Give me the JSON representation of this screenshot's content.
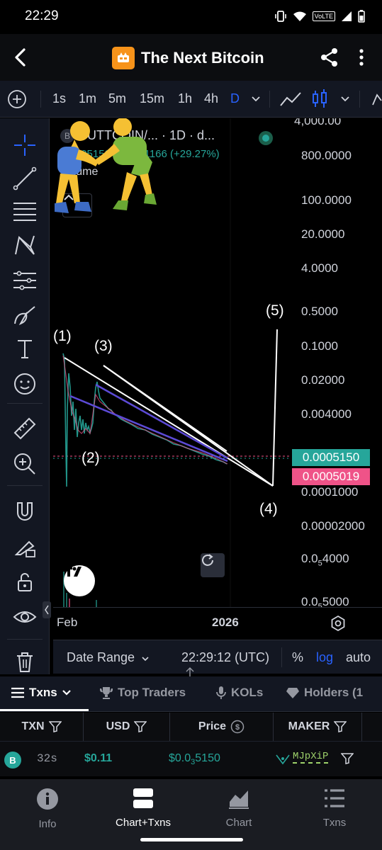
{
  "status_bar": {
    "time": "22:29",
    "network_label": "VoLTE",
    "icons": [
      "vibrate-icon",
      "wifi-icon",
      "volte-icon",
      "signal-icon",
      "battery-icon"
    ]
  },
  "header": {
    "title": "The Next Bitcoin",
    "logo_color": "#f7931a"
  },
  "toolbar": {
    "timeframes": [
      "1s",
      "1m",
      "5m",
      "15m",
      "1h",
      "4h",
      "D"
    ],
    "active_timeframe": "D"
  },
  "chart": {
    "symbol_initial": "B",
    "symbol_line": "BUTTCOIN/...  · 1D · d...",
    "price": "0.0005150",
    "change": "0.0001166 (+29.27%)",
    "volume_label": "Volume",
    "price_scale": [
      "4,000.00",
      "800.0000",
      "100.0000",
      "20.0000",
      "4.0000",
      "0.5000",
      "0.1000",
      "0.02000",
      "0.004000",
      "0.0001000",
      "0.00002000"
    ],
    "price_scale_sub_1": {
      "lead": "0.0",
      "sub": "5",
      "tail": "4000"
    },
    "price_scale_sub_2": {
      "lead": "0.0",
      "sub": "5",
      "tail": "5000"
    },
    "last_price_badge": "0.0005150",
    "second_price_badge": "0.0005019",
    "wave_labels": [
      "(1)",
      "(2)",
      "(3)",
      "(4)",
      "(5)"
    ],
    "time_labels": [
      "Feb",
      "2026"
    ],
    "accent_green": "#26a69a",
    "accent_pink": "#ef5388",
    "accent_blue": "#2962ff"
  },
  "range_bar": {
    "date_range": "Date Range",
    "clock": "22:29:12 (UTC)",
    "percent": "%",
    "log": "log",
    "auto": "auto"
  },
  "tabs": {
    "txns": "Txns",
    "top_traders": "Top Traders",
    "kols": "KOLs",
    "holders": "Holders (1"
  },
  "table": {
    "headers": [
      "TXN",
      "USD",
      "Price",
      "MAKER"
    ],
    "row": {
      "side": "B",
      "age": "32s",
      "usd": "$0.11",
      "price_lead": "$0.0",
      "price_sub": "3",
      "price_tail": "5150",
      "maker": "MJpXiP"
    }
  },
  "bottom_nav": [
    "Info",
    "Chart+Txns",
    "Chart",
    "Txns"
  ]
}
